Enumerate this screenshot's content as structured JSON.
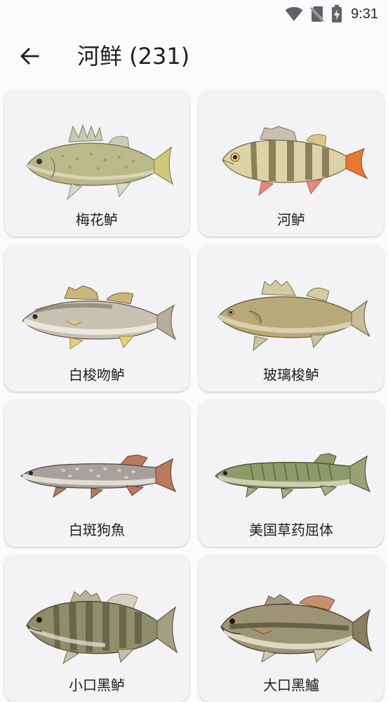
{
  "status_bar": {
    "time": "9:31",
    "icons": [
      "wifi-icon",
      "no-sim-icon",
      "battery-charging-icon"
    ]
  },
  "header": {
    "back_icon": "arrow-left-icon",
    "title": "河鲜 (231)"
  },
  "fish_list": [
    {
      "name": "梅花鲈",
      "image": "zander-perch-illustration"
    },
    {
      "name": "河鲈",
      "image": "european-perch-illustration"
    },
    {
      "name": "白梭吻鲈",
      "image": "pike-perch-illustration"
    },
    {
      "name": "玻璃梭鲈",
      "image": "walleye-illustration"
    },
    {
      "name": "白斑狗魚",
      "image": "northern-pike-illustration"
    },
    {
      "name": "美国草药屈体",
      "image": "grass-pickerel-illustration"
    },
    {
      "name": "小口黑鲈",
      "image": "smallmouth-bass-illustration"
    },
    {
      "name": "大口黑鱸",
      "image": "largemouth-bass-illustration"
    }
  ]
}
